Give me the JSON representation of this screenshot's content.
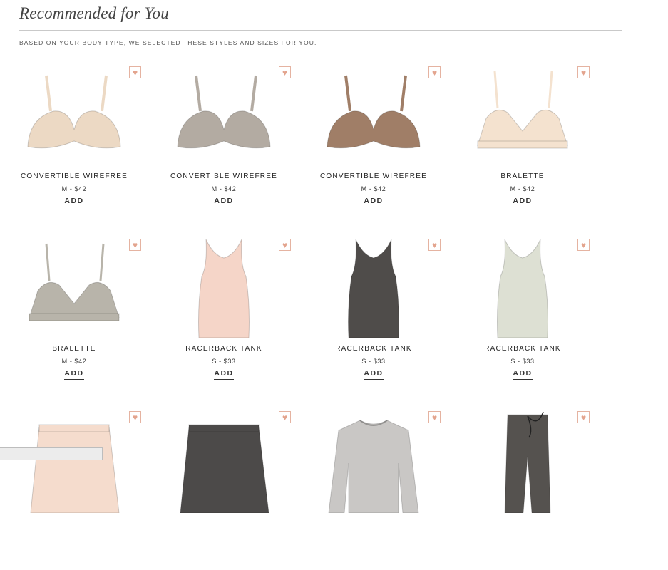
{
  "header": {
    "title": "Recommended for You",
    "subtitle": "BASED ON YOUR BODY TYPE, WE SELECTED THESE STYLES AND SIZES FOR YOU."
  },
  "products": [
    {
      "name": "CONVERTIBLE WIREFREE",
      "meta": "M - $42",
      "add_label": "ADD",
      "fav_icon": "♥",
      "icon": "bra-wirefree-icon",
      "color": "#ecd9c4"
    },
    {
      "name": "CONVERTIBLE WIREFREE",
      "meta": "M - $42",
      "add_label": "ADD",
      "fav_icon": "♥",
      "icon": "bra-wirefree-icon",
      "color": "#b3aba2"
    },
    {
      "name": "CONVERTIBLE WIREFREE",
      "meta": "M - $42",
      "add_label": "ADD",
      "fav_icon": "♥",
      "icon": "bra-wirefree-icon",
      "color": "#a07e67"
    },
    {
      "name": "BRALETTE",
      "meta": "M - $42",
      "add_label": "ADD",
      "fav_icon": "♥",
      "icon": "bralette-icon",
      "color": "#f4e2cf"
    },
    {
      "name": "BRALETTE",
      "meta": "M - $42",
      "add_label": "ADD",
      "fav_icon": "♥",
      "icon": "bralette-icon",
      "color": "#b8b4aa"
    },
    {
      "name": "RACERBACK TANK",
      "meta": "S - $33",
      "add_label": "ADD",
      "fav_icon": "♥",
      "icon": "tank-icon",
      "color": "#f5d5c8"
    },
    {
      "name": "RACERBACK TANK",
      "meta": "S - $33",
      "add_label": "ADD",
      "fav_icon": "♥",
      "icon": "tank-icon",
      "color": "#4f4c4a"
    },
    {
      "name": "RACERBACK TANK",
      "meta": "S - $33",
      "add_label": "ADD",
      "fav_icon": "♥",
      "icon": "tank-icon",
      "color": "#dde0d3"
    },
    {
      "name": "",
      "meta": "",
      "add_label": "",
      "fav_icon": "♥",
      "icon": "shorts-icon",
      "color": "#f5dccd"
    },
    {
      "name": "",
      "meta": "",
      "add_label": "",
      "fav_icon": "♥",
      "icon": "shorts-icon",
      "color": "#4c4a49"
    },
    {
      "name": "",
      "meta": "",
      "add_label": "",
      "fav_icon": "♥",
      "icon": "sweatshirt-icon",
      "color": "#c9c7c5"
    },
    {
      "name": "",
      "meta": "",
      "add_label": "",
      "fav_icon": "♥",
      "icon": "pants-icon",
      "color": "#55524f"
    }
  ]
}
